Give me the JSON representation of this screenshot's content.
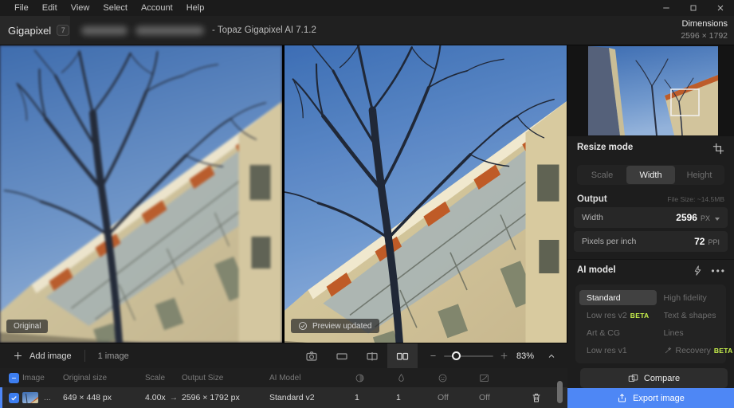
{
  "app": {
    "name": "Gigapixel",
    "version_badge": "7",
    "title_suffix": "- Topaz Gigapixel AI 7.1.2"
  },
  "menu_bar": {
    "items": [
      "File",
      "Edit",
      "View",
      "Select",
      "Account",
      "Help"
    ]
  },
  "header": {
    "dimensions_label": "Dimensions",
    "dimensions_value": "2596 × 1792"
  },
  "canvas": {
    "original_badge": "Original",
    "preview_badge": "Preview updated"
  },
  "resize_panel": {
    "title": "Resize mode",
    "tabs": [
      {
        "label": "Scale",
        "active": false
      },
      {
        "label": "Width",
        "active": true
      },
      {
        "label": "Height",
        "active": false
      }
    ],
    "output_label": "Output",
    "file_size": "File Size: ~14.5MB",
    "fields": [
      {
        "label": "Width",
        "value": "2596",
        "unit": "PX"
      },
      {
        "label": "Pixels per inch",
        "value": "72",
        "unit": "PPI"
      }
    ]
  },
  "ai_model_panel": {
    "title": "AI model",
    "models": [
      {
        "label": "Standard",
        "active": true
      },
      {
        "label": "High fidelity",
        "active": false
      },
      {
        "label": "Low res v2",
        "active": false,
        "badge": "BETA"
      },
      {
        "label": "Text & shapes",
        "active": false
      },
      {
        "label": "Art & CG",
        "active": false
      },
      {
        "label": "Lines",
        "active": false
      },
      {
        "label": "Low res v1",
        "active": false
      },
      {
        "label": "Recovery",
        "active": false,
        "badge": "BETA"
      }
    ]
  },
  "footer_actions": {
    "compare_label": "Compare",
    "export_label": "Export image"
  },
  "toolbar": {
    "add_image_label": "Add image",
    "image_count": "1 image",
    "zoom_percent": "83%"
  },
  "queue_table": {
    "headers": {
      "image": "Image",
      "original_size": "Original size",
      "scale": "Scale",
      "output_size": "Output Size",
      "ai_model": "AI Model"
    },
    "row": {
      "ellipsis": "...",
      "original_size": "649 × 448 px",
      "scale": "4.00x",
      "arrow": "→",
      "output_size": "2596 × 1792 px",
      "ai_model": "Standard v2",
      "sharpen": "1",
      "denoise": "1",
      "face_recovery": "Off",
      "gamma": "Off"
    }
  },
  "colors": {
    "accent_blue": "#4e87f5",
    "beta_green": "#c8f04c",
    "selection_blue": "#3d7ef0"
  }
}
